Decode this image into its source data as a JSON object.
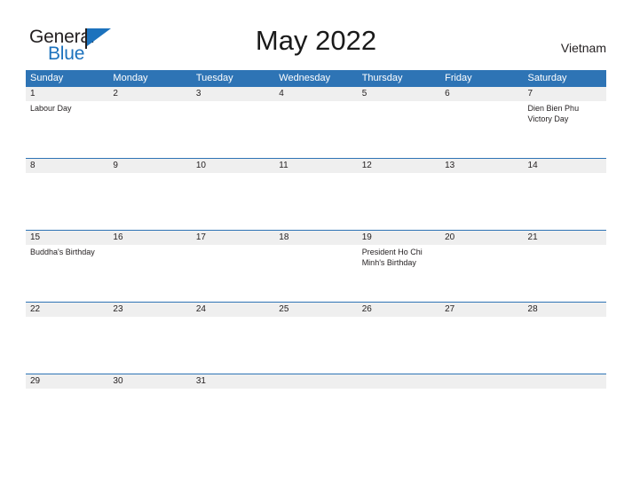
{
  "logo": {
    "word_one": "General",
    "word_two": "Blue",
    "flag_icon": "blue-triangle-flag-icon",
    "color_dark": "#231f20",
    "color_blue": "#1c72bd"
  },
  "header": {
    "title": "May 2022",
    "country": "Vietnam"
  },
  "theme": {
    "header_blue": "#2e74b5",
    "date_strip_gray": "#efefef",
    "text_dark": "#231f20",
    "page_background": "#ffffff"
  },
  "calendar": {
    "month": "May",
    "year": "2022",
    "weekdays": [
      "Sunday",
      "Monday",
      "Tuesday",
      "Wednesday",
      "Thursday",
      "Friday",
      "Saturday"
    ],
    "weeks": [
      {
        "days": [
          {
            "date": "1",
            "events": [
              "Labour Day"
            ]
          },
          {
            "date": "2",
            "events": []
          },
          {
            "date": "3",
            "events": []
          },
          {
            "date": "4",
            "events": []
          },
          {
            "date": "5",
            "events": []
          },
          {
            "date": "6",
            "events": []
          },
          {
            "date": "7",
            "events": [
              "Dien Bien Phu Victory Day"
            ]
          }
        ]
      },
      {
        "days": [
          {
            "date": "8",
            "events": []
          },
          {
            "date": "9",
            "events": []
          },
          {
            "date": "10",
            "events": []
          },
          {
            "date": "11",
            "events": []
          },
          {
            "date": "12",
            "events": []
          },
          {
            "date": "13",
            "events": []
          },
          {
            "date": "14",
            "events": []
          }
        ]
      },
      {
        "days": [
          {
            "date": "15",
            "events": [
              "Buddha's Birthday"
            ]
          },
          {
            "date": "16",
            "events": []
          },
          {
            "date": "17",
            "events": []
          },
          {
            "date": "18",
            "events": []
          },
          {
            "date": "19",
            "events": [
              "President Ho Chi Minh's Birthday"
            ]
          },
          {
            "date": "20",
            "events": []
          },
          {
            "date": "21",
            "events": []
          }
        ]
      },
      {
        "days": [
          {
            "date": "22",
            "events": []
          },
          {
            "date": "23",
            "events": []
          },
          {
            "date": "24",
            "events": []
          },
          {
            "date": "25",
            "events": []
          },
          {
            "date": "26",
            "events": []
          },
          {
            "date": "27",
            "events": []
          },
          {
            "date": "28",
            "events": []
          }
        ]
      },
      {
        "days": [
          {
            "date": "29",
            "events": []
          },
          {
            "date": "30",
            "events": []
          },
          {
            "date": "31",
            "events": []
          },
          {
            "date": "",
            "events": []
          },
          {
            "date": "",
            "events": []
          },
          {
            "date": "",
            "events": []
          },
          {
            "date": "",
            "events": []
          }
        ]
      }
    ]
  }
}
